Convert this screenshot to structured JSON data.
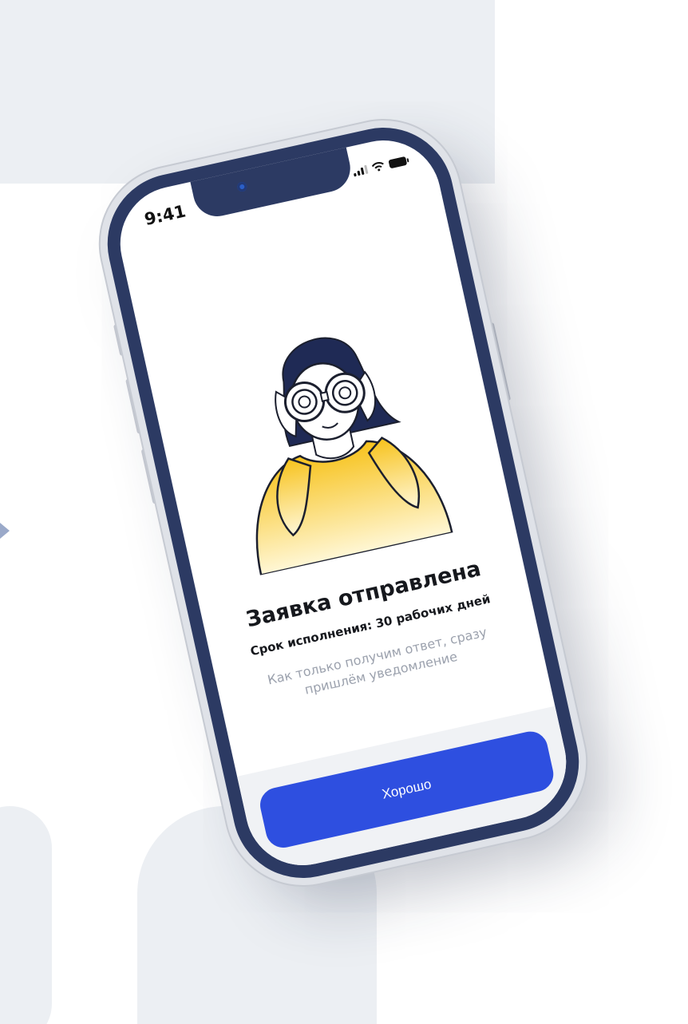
{
  "status_bar": {
    "time": "9:41",
    "icons": [
      "signal-icon",
      "wifi-icon",
      "battery-icon"
    ]
  },
  "screen": {
    "title": "Заявка отправлена",
    "subtitle": "Срок исполнения: 30 рабочих дней",
    "message": "Как только получим ответ, сразу пришлём уведомление",
    "illustration": "woman-with-binoculars"
  },
  "actions": {
    "ok_label": "Хорошо"
  },
  "colors": {
    "accent": "#2e4fe0",
    "phone_frame": "#2c3a63",
    "illustration_fill": "#f7c21b",
    "muted_text": "#9ba1ad"
  }
}
